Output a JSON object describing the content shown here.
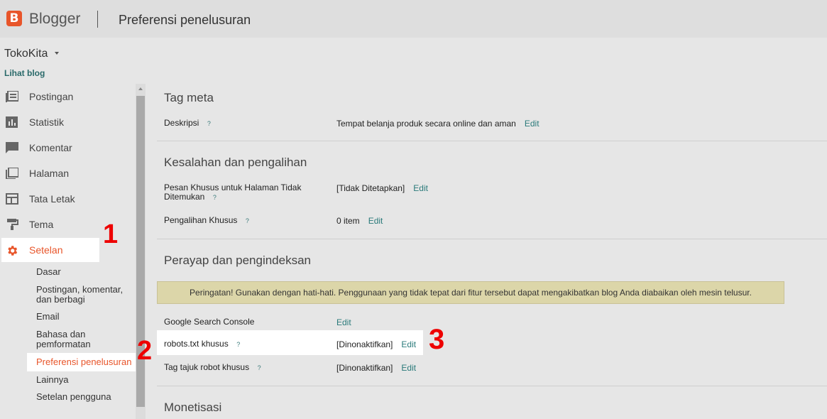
{
  "header": {
    "logo_letter": "B",
    "brand": "Blogger",
    "title": "Preferensi penelusuran"
  },
  "sidebar": {
    "blog_name": "TokoKita",
    "view_blog": "Lihat blog",
    "items": [
      {
        "label": "Postingan",
        "icon": "posts-icon"
      },
      {
        "label": "Statistik",
        "icon": "stats-icon"
      },
      {
        "label": "Komentar",
        "icon": "comment-icon"
      },
      {
        "label": "Halaman",
        "icon": "pages-icon"
      },
      {
        "label": "Tata Letak",
        "icon": "layout-icon"
      },
      {
        "label": "Tema",
        "icon": "paint-roller-icon"
      },
      {
        "label": "Setelan",
        "icon": "gear-icon",
        "active": true
      }
    ],
    "sub_items": [
      {
        "label": "Dasar"
      },
      {
        "label": "Postingan, komentar, dan berbagi"
      },
      {
        "label": "Email"
      },
      {
        "label": "Bahasa dan pemformatan"
      },
      {
        "label": "Preferensi penelusuran",
        "active": true
      },
      {
        "label": "Lainnya"
      },
      {
        "label": "Setelan pengguna"
      }
    ]
  },
  "markers": [
    "1",
    "2",
    "3"
  ],
  "help_symbol": "?",
  "edit_label": "Edit",
  "sections": {
    "meta": {
      "title": "Tag meta",
      "rows": [
        {
          "label": "Deskripsi",
          "value": "Tempat belanja produk secara online dan aman"
        }
      ]
    },
    "errors": {
      "title": "Kesalahan dan pengalihan",
      "rows": [
        {
          "label": "Pesan Khusus untuk Halaman Tidak Ditemukan",
          "value": "[Tidak Ditetapkan]"
        },
        {
          "label": "Pengalihan Khusus",
          "value": "0 item"
        }
      ]
    },
    "crawl": {
      "title": "Perayap dan pengindeksan",
      "warning": "Peringatan! Gunakan dengan hati-hati. Penggunaan yang tidak tepat dari fitur tersebut dapat mengakibatkan blog Anda diabaikan oleh mesin telusur.",
      "rows": [
        {
          "label": "Google Search Console",
          "value": ""
        },
        {
          "label": "robots.txt khusus",
          "value": "[Dinonaktifkan]"
        },
        {
          "label": "Tag tajuk robot khusus",
          "value": "[Dinonaktifkan]"
        }
      ]
    },
    "monetization": {
      "title": "Monetisasi"
    }
  },
  "colors": {
    "accent": "#e8552a",
    "link": "#2a7a7a",
    "marker": "#ee0000",
    "warning_bg": "#dcd6a9"
  }
}
